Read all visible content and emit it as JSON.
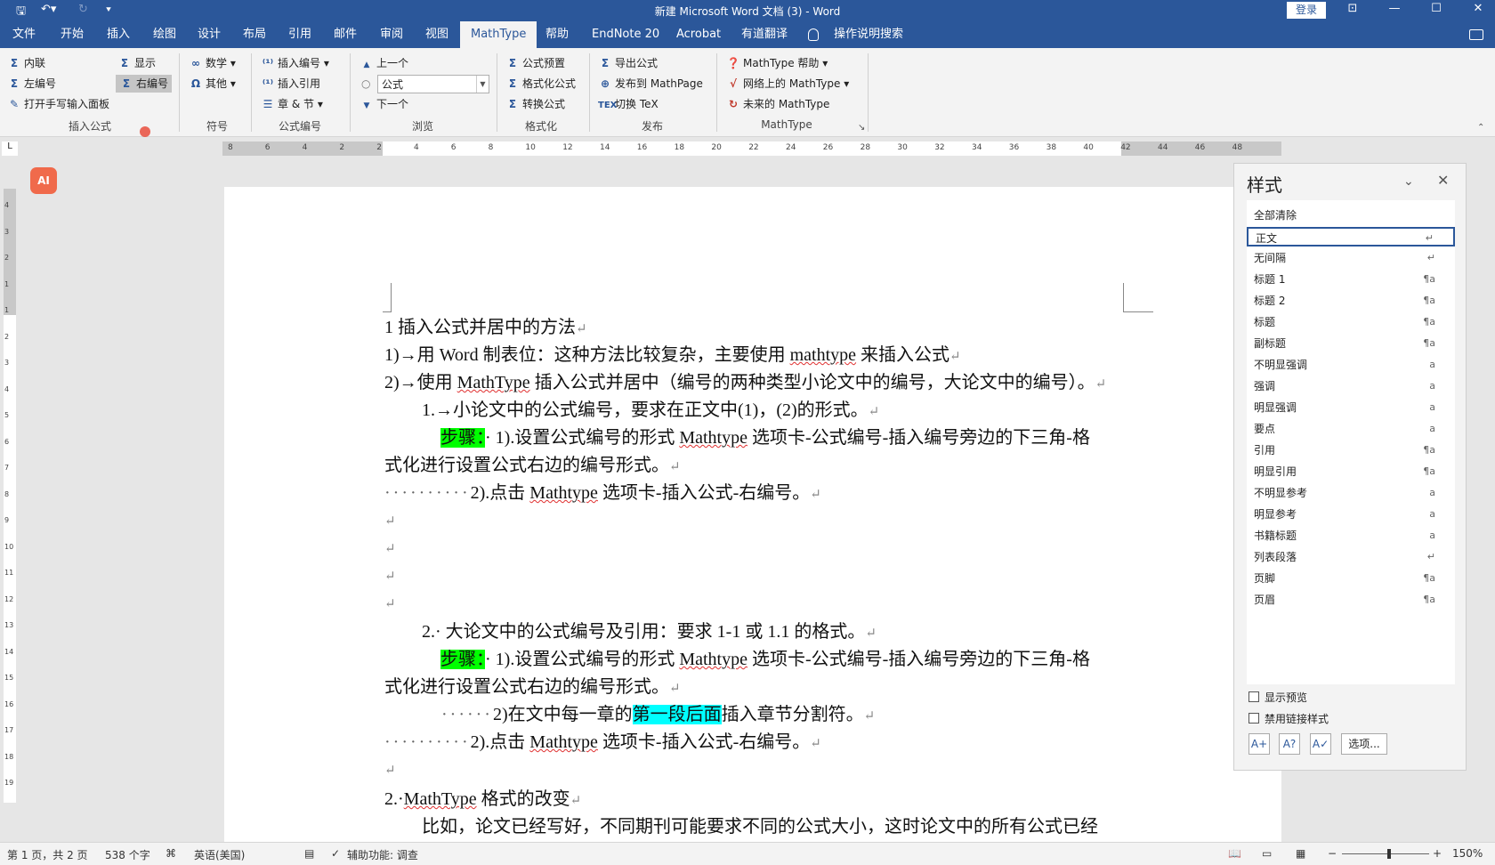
{
  "titlebar": {
    "title": "新建 Microsoft Word 文档 (3)  -  Word",
    "login": "登录"
  },
  "tabs": [
    "文件",
    "开始",
    "插入",
    "绘图",
    "设计",
    "布局",
    "引用",
    "邮件",
    "审阅",
    "视图",
    "MathType",
    "帮助",
    "EndNote 20",
    "Acrobat",
    "有道翻译"
  ],
  "active_tab": "MathType",
  "tell_me": "操作说明搜索",
  "ribbon": {
    "insert_formula": {
      "inline": "内联",
      "display": "显示",
      "left_number": "左编号",
      "right_number": "右编号",
      "handwriting": "打开手写输入面板",
      "group": "插入公式"
    },
    "symbols": {
      "math": "数学",
      "other": "其他",
      "group": "符号"
    },
    "formula_number": {
      "insert_number": "插入编号",
      "insert_ref": "插入引用",
      "chapter": "章 & 节",
      "group": "公式编号"
    },
    "browse": {
      "prev": "上一个",
      "combo": "公式",
      "next": "下一个",
      "group": "浏览"
    },
    "format": {
      "preset": "公式预置",
      "format_formula": "格式化公式",
      "convert": "转换公式",
      "group": "格式化"
    },
    "publish": {
      "export": "导出公式",
      "mathpage": "发布到 MathPage",
      "tex": "切换 TeX",
      "group": "发布"
    },
    "mathtype": {
      "help": "MathType 帮助",
      "online": "网络上的 MathType",
      "future": "未来的 MathType",
      "group": "MathType"
    }
  },
  "ruler": {
    "h_ticks": [
      "8",
      "6",
      "4",
      "2",
      "2",
      "4",
      "6",
      "8",
      "10",
      "12",
      "14",
      "16",
      "18",
      "20",
      "22",
      "24",
      "26",
      "28",
      "30",
      "32",
      "34",
      "36",
      "38",
      "40",
      "42",
      "44",
      "46",
      "48"
    ],
    "v_ticks": [
      "4",
      "3",
      "2",
      "1",
      "1",
      "2",
      "3",
      "4",
      "5",
      "6",
      "7",
      "8",
      "9",
      "10",
      "11",
      "12",
      "13",
      "14",
      "15",
      "16",
      "17",
      "18",
      "19"
    ],
    "tab_selector": "L"
  },
  "doc": {
    "l1": "1 插入公式并居中的方法",
    "l2a": "1)→用 Word 制表位：这种方法比较复杂，主要使用 ",
    "l2b": "mathtype",
    "l2c": " 来插入公式",
    "l3a": "2)→使用 ",
    "l3b": "MathType",
    "l3c": " 插入公式并居中（编号的两种类型小论文中的编号，大论文中的编号）。",
    "l4": "1.→小论文中的公式编号，要求在正文中(1)，(2)的形式。",
    "step": "步骤：",
    "l5a": "· 1).设置公式编号的形式 ",
    "l5b": "Mathtype",
    "l5c": " 选项卡-公式编号-插入编号旁边的下三角-格",
    "l6": "式化进行设置公式右边的编号形式。",
    "l7dots": "··········",
    "l7a": "2).点击 ",
    "l7b": "Mathtype",
    "l7c": " 选项卡-插入公式-右编号。",
    "l12": "2.· 大论文中的公式编号及引用：要求 1-1 或 1.1 的格式。",
    "l13a": "· 1).设置公式编号的形式 ",
    "l13b": "Mathtype",
    "l13c": " 选项卡-公式编号-插入编号旁边的下三角-格",
    "l14": "式化进行设置公式右边的编号形式。",
    "l15dots": "······",
    "l15a": "2)在文中每一章的",
    "l15b": "第一段后面",
    "l15c": "插入章节分割符。",
    "l16dots": "··········",
    "l16a": "2).点击 ",
    "l16b": "Mathtype",
    "l16c": " 选项卡-插入公式-右编号。",
    "l18a": "2.·",
    "l18b": "MathType",
    "l18c": " 格式的改变",
    "l19": "比如，论文已经写好，不同期刊可能要求不同的公式大小，这时论文中的所有公式已经",
    "para_mark": "↵"
  },
  "styles_pane": {
    "title": "样式",
    "items": [
      {
        "label": "全部清除",
        "mark": ""
      },
      {
        "label": "正文",
        "mark": "↵"
      },
      {
        "label": "无间隔",
        "mark": "↵"
      },
      {
        "label": "标题 1",
        "mark": "¶a"
      },
      {
        "label": "标题 2",
        "mark": "¶a"
      },
      {
        "label": "标题",
        "mark": "¶a"
      },
      {
        "label": "副标题",
        "mark": "¶a"
      },
      {
        "label": "不明显强调",
        "mark": "a"
      },
      {
        "label": "强调",
        "mark": "a"
      },
      {
        "label": "明显强调",
        "mark": "a"
      },
      {
        "label": "要点",
        "mark": "a"
      },
      {
        "label": "引用",
        "mark": "¶a"
      },
      {
        "label": "明显引用",
        "mark": "¶a"
      },
      {
        "label": "不明显参考",
        "mark": "a"
      },
      {
        "label": "明显参考",
        "mark": "a"
      },
      {
        "label": "书籍标题",
        "mark": "a"
      },
      {
        "label": "列表段落",
        "mark": "↵"
      },
      {
        "label": "页脚",
        "mark": "¶a"
      },
      {
        "label": "页眉",
        "mark": "¶a"
      }
    ],
    "show_preview": "显示预览",
    "disable_linked": "禁用链接样式",
    "options": "选项..."
  },
  "status": {
    "page": "第 1 页，共 2 页",
    "words": "538 个字",
    "language": "英语(美国)",
    "accessibility": "辅助功能: 调查",
    "zoom": "150%"
  },
  "colors": {
    "brand": "#2b579a",
    "highlight_green": "#00ff00",
    "highlight_cyan": "#00ffff"
  }
}
